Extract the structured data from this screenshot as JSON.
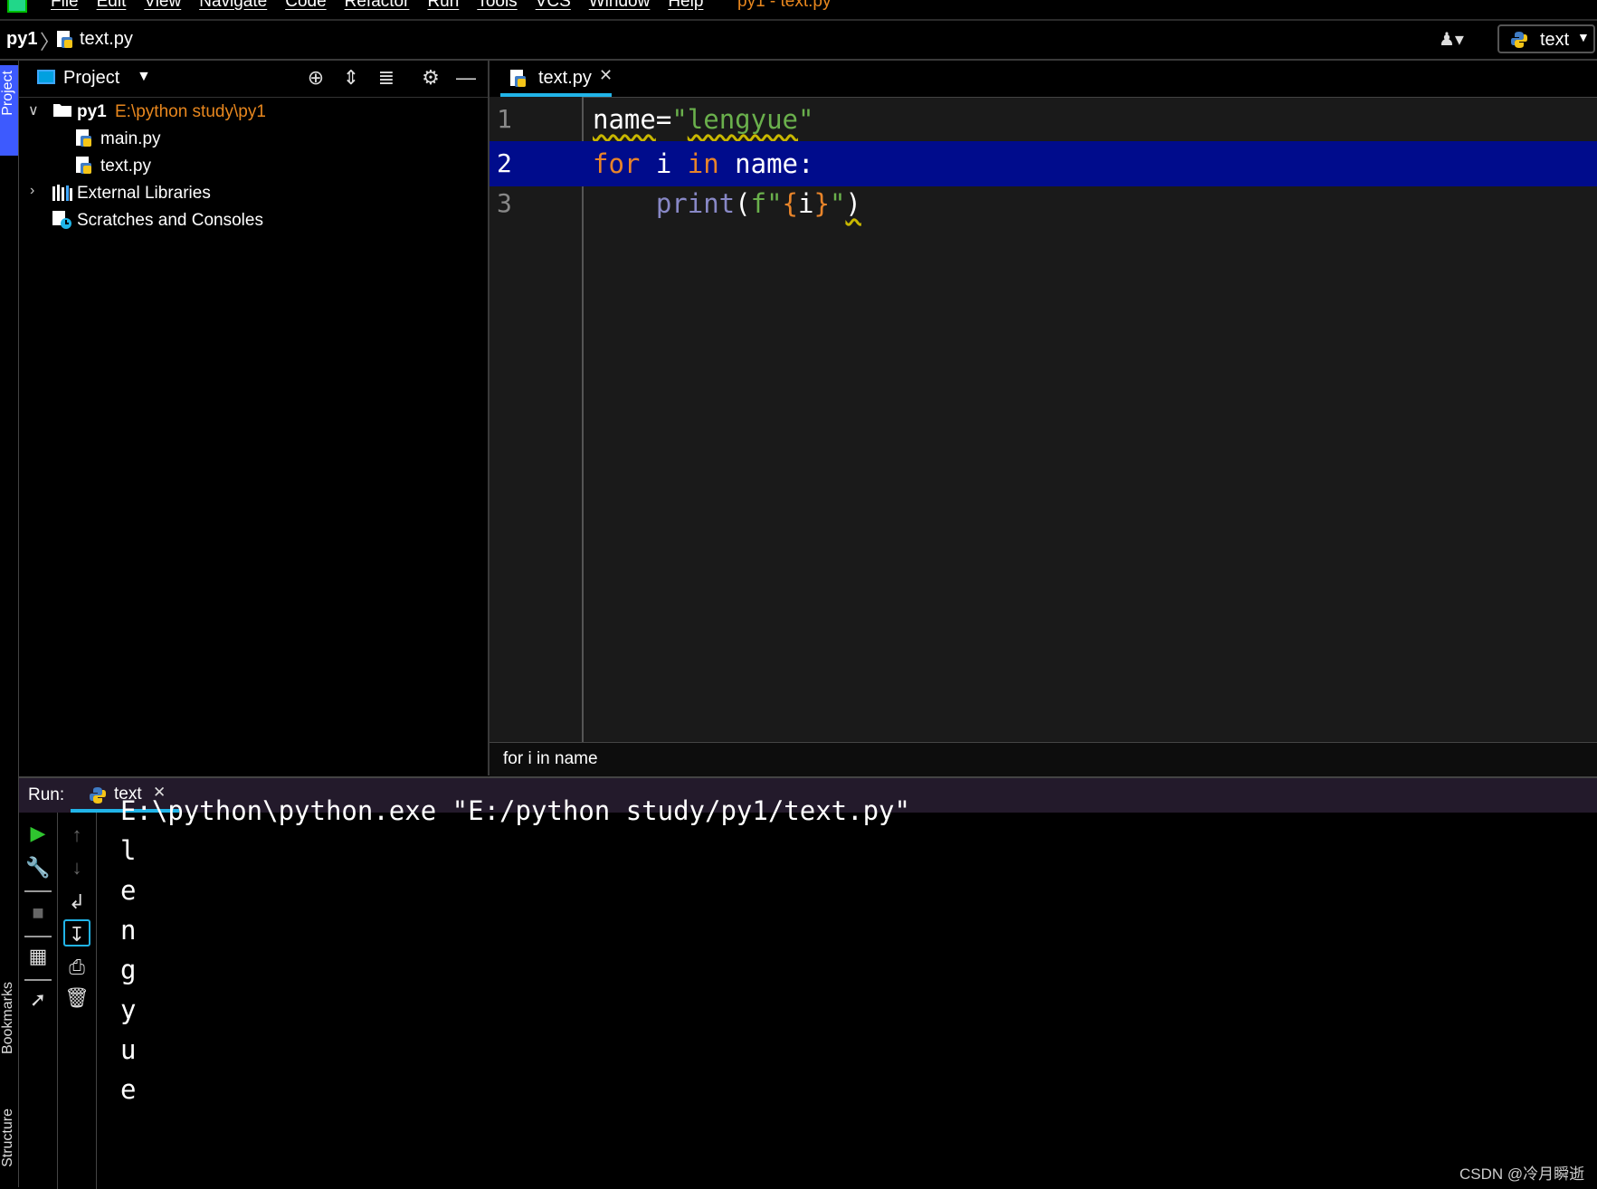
{
  "menubar": {
    "items": [
      "File",
      "Edit",
      "View",
      "Navigate",
      "Code",
      "Refactor",
      "Run",
      "Tools",
      "VCS",
      "Window",
      "Help"
    ],
    "title": "py1 - text.py"
  },
  "navbar": {
    "project": "py1",
    "file": "text.py",
    "run_config": "text"
  },
  "stripe": {
    "project": "Project",
    "bookmarks": "Bookmarks",
    "structure": "Structure"
  },
  "project_panel": {
    "title": "Project",
    "root_name": "py1",
    "root_path": "E:\\python study\\py1",
    "files": [
      "main.py",
      "text.py"
    ],
    "external_libraries": "External Libraries",
    "scratches": "Scratches and Consoles"
  },
  "editor": {
    "tab": "text.py",
    "lines": [
      {
        "number": "1"
      },
      {
        "number": "2"
      },
      {
        "number": "3"
      }
    ],
    "breadcrumb": "for i in name"
  },
  "run": {
    "title": "Run:",
    "tab": "text",
    "output": [
      "E:\\python\\python.exe \"E:/python study/py1/text.py\"",
      "l",
      "e",
      "n",
      "g",
      "y",
      "u",
      "e"
    ]
  },
  "watermark": "CSDN @冷月瞬逝",
  "colors": {
    "keyword": "#e8842a",
    "string": "#6ab04c",
    "builtin": "#8888c6",
    "accent": "#21b4e8",
    "current_line": "#000c8c",
    "project_stripe": "#3d5afe"
  }
}
